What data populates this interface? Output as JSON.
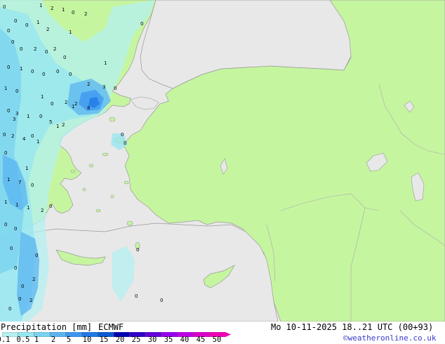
{
  "title": "Precipitation [mm]",
  "model": "ECMWF",
  "valid_time": "Mo 10-11-2025 18..21 UTC (00+93)",
  "credit": "©weatheronline.co.uk",
  "scale": {
    "ticks": [
      "0.1",
      "0.5",
      "1",
      "2",
      "5",
      "10",
      "15",
      "20",
      "25",
      "30",
      "35",
      "40",
      "45",
      "50"
    ],
    "colors": [
      "#b4f0f0",
      "#96e6f0",
      "#78d2f0",
      "#5ab4f0",
      "#3c96f0",
      "#1e78e6",
      "#0a5ad2",
      "#0000b4",
      "#3200c8",
      "#6400dc",
      "#9600f0",
      "#be00e6",
      "#dc00c8",
      "#f000b4"
    ]
  },
  "map": {
    "colors": {
      "sea": "#e8e8e8",
      "land": "#c6f5a0",
      "coast": "#999999"
    },
    "values": [
      {
        "v": "0"
      },
      {
        "v": "1"
      },
      {
        "v": "2"
      },
      {
        "v": "0"
      },
      {
        "v": "2"
      },
      {
        "v": "1"
      },
      {
        "v": "0"
      },
      {
        "v": "0"
      },
      {
        "v": "1"
      },
      {
        "v": "0"
      },
      {
        "v": "1"
      },
      {
        "v": "0"
      },
      {
        "v": "0"
      },
      {
        "v": "2"
      },
      {
        "v": "0"
      },
      {
        "v": "2"
      },
      {
        "v": "2"
      },
      {
        "v": "0"
      },
      {
        "v": "0"
      },
      {
        "v": "1"
      },
      {
        "v": "0"
      },
      {
        "v": "1"
      },
      {
        "v": "0"
      },
      {
        "v": "0"
      },
      {
        "v": "0"
      },
      {
        "v": "0"
      },
      {
        "v": "2"
      },
      {
        "v": "0"
      },
      {
        "v": "1"
      },
      {
        "v": "0"
      },
      {
        "v": "1"
      },
      {
        "v": "0"
      },
      {
        "v": "2"
      },
      {
        "v": "3"
      },
      {
        "v": "0"
      },
      {
        "v": "1"
      },
      {
        "v": "2"
      },
      {
        "v": "3"
      },
      {
        "v": "8"
      },
      {
        "v": "2"
      },
      {
        "v": "1"
      },
      {
        "v": "0"
      },
      {
        "v": "3"
      },
      {
        "v": "0"
      },
      {
        "v": "0"
      },
      {
        "v": "5"
      },
      {
        "v": "1"
      },
      {
        "v": "0"
      },
      {
        "v": "0"
      },
      {
        "v": "2"
      },
      {
        "v": "4"
      },
      {
        "v": "1"
      },
      {
        "v": "0"
      },
      {
        "v": "1"
      },
      {
        "v": "1"
      },
      {
        "v": "7"
      },
      {
        "v": "0"
      },
      {
        "v": "1"
      },
      {
        "v": "1"
      },
      {
        "v": "2"
      },
      {
        "v": "0"
      },
      {
        "v": "1"
      },
      {
        "v": "0"
      },
      {
        "v": "0"
      },
      {
        "v": "0"
      },
      {
        "v": "0"
      },
      {
        "v": "2"
      },
      {
        "v": "0"
      },
      {
        "v": "0"
      },
      {
        "v": "0"
      },
      {
        "v": "0"
      },
      {
        "v": "2"
      },
      {
        "v": "0"
      },
      {
        "v": "0"
      },
      {
        "v": "0"
      }
    ]
  }
}
